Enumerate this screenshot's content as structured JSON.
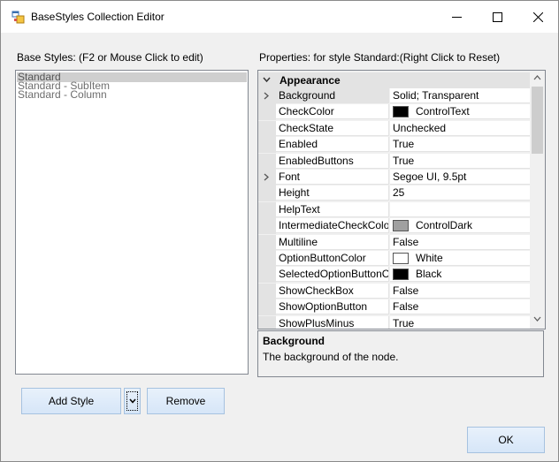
{
  "window": {
    "title": "BaseStyles Collection Editor"
  },
  "left_panel": {
    "label": "Base Styles: (F2 or Mouse Click to edit)",
    "items": [
      "Standard",
      "Standard - SubItem",
      "Standard - Column"
    ],
    "selected_index": 0
  },
  "right_panel": {
    "label": "Properties: for style Standard:(Right Click to Reset)",
    "category": "Appearance",
    "properties": [
      {
        "name": "Background",
        "value": "Solid; Transparent",
        "swatch": null,
        "expandable": true
      },
      {
        "name": "CheckColor",
        "value": "ControlText",
        "swatch": "#000000",
        "expandable": false
      },
      {
        "name": "CheckState",
        "value": "Unchecked",
        "swatch": null,
        "expandable": false
      },
      {
        "name": "Enabled",
        "value": "True",
        "swatch": null,
        "expandable": false
      },
      {
        "name": "EnabledButtons",
        "value": "True",
        "swatch": null,
        "expandable": false
      },
      {
        "name": "Font",
        "value": "Segoe UI, 9.5pt",
        "swatch": null,
        "expandable": true
      },
      {
        "name": "Height",
        "value": "25",
        "swatch": null,
        "expandable": false
      },
      {
        "name": "HelpText",
        "value": "",
        "swatch": null,
        "expandable": false
      },
      {
        "name": "IntermediateCheckColo",
        "value": "ControlDark",
        "swatch": "#a0a0a0",
        "expandable": false
      },
      {
        "name": "Multiline",
        "value": "False",
        "swatch": null,
        "expandable": false
      },
      {
        "name": "OptionButtonColor",
        "value": "White",
        "swatch": "#ffffff",
        "expandable": false
      },
      {
        "name": "SelectedOptionButtonC",
        "value": "Black",
        "swatch": "#000000",
        "expandable": false
      },
      {
        "name": "ShowCheckBox",
        "value": "False",
        "swatch": null,
        "expandable": false
      },
      {
        "name": "ShowOptionButton",
        "value": "False",
        "swatch": null,
        "expandable": false
      },
      {
        "name": "ShowPlusMinus",
        "value": "True",
        "swatch": null,
        "expandable": false
      }
    ],
    "selected_property": "Background",
    "description": {
      "title": "Background",
      "text": "The background of the node."
    }
  },
  "buttons": {
    "add_style": "Add Style",
    "remove": "Remove",
    "ok": "OK"
  },
  "icons": {
    "app": "collection-editor-icon",
    "minimize": "minimize-icon",
    "maximize": "maximize-icon",
    "close": "close-icon"
  }
}
